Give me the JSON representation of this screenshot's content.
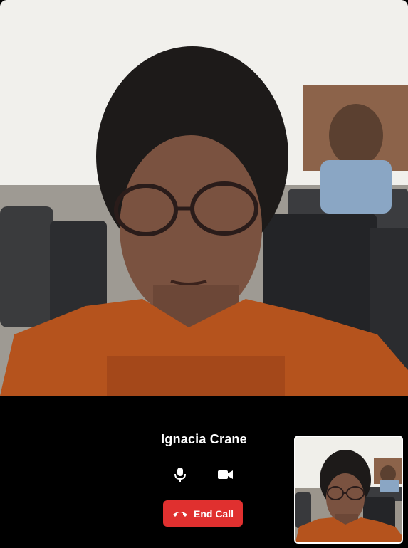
{
  "call": {
    "caller_name": "Ignacia Crane",
    "end_call_label": "End Call"
  },
  "icons": {
    "microphone": "microphone-icon",
    "camera": "video-camera-icon",
    "hangup": "phone-hangup-icon"
  },
  "colors": {
    "background": "#000000",
    "end_call": "#e0302f",
    "text": "#ffffff"
  }
}
